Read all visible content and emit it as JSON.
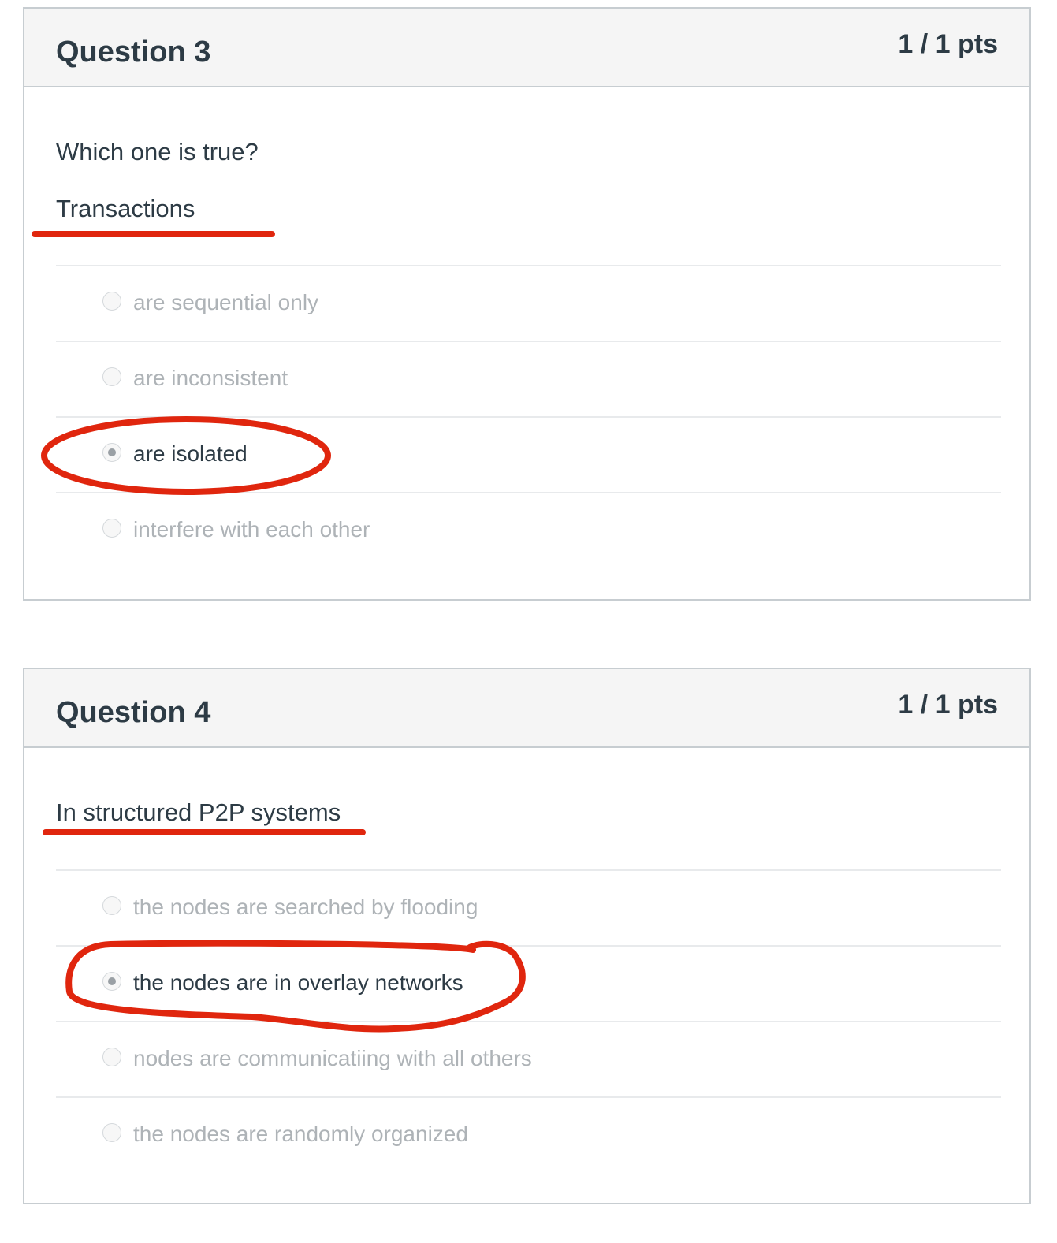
{
  "questions": [
    {
      "title": "Question 3",
      "points": "1 / 1 pts",
      "prompt": "Which one is true?",
      "stem": "Transactions",
      "answers": [
        {
          "label": "are sequential only",
          "selected": false
        },
        {
          "label": "are inconsistent",
          "selected": false
        },
        {
          "label": "are isolated",
          "selected": true
        },
        {
          "label": "interfere with each other",
          "selected": false
        }
      ]
    },
    {
      "title": "Question 4",
      "points": "1 / 1 pts",
      "stem": "In structured P2P systems",
      "answers": [
        {
          "label": "the nodes are searched by flooding",
          "selected": false
        },
        {
          "label": "the nodes are in overlay networks",
          "selected": true
        },
        {
          "label": "nodes are communicatiing with all others",
          "selected": false
        },
        {
          "label": "the nodes are randomly organized",
          "selected": false
        }
      ]
    }
  ],
  "annotation_color": "#e0260e"
}
